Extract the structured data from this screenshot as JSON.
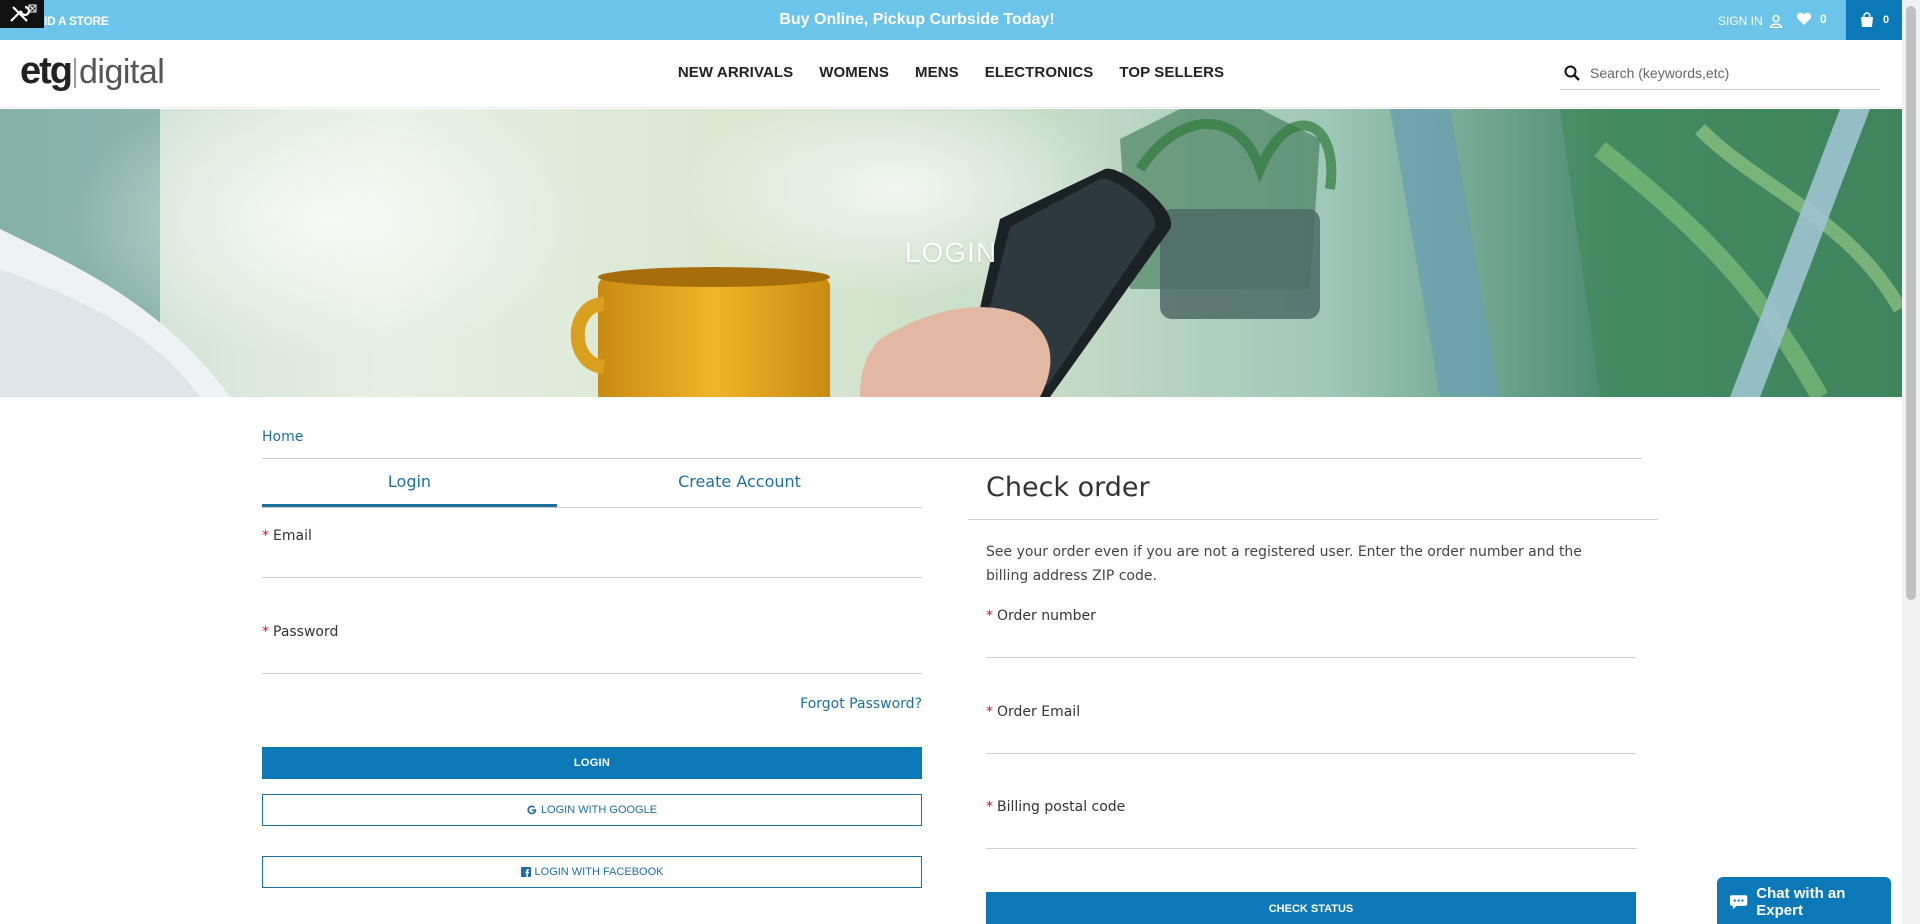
{
  "topbar": {
    "find_store": "ID A STORE",
    "promo": "Buy Online, Pickup Curbside Today!",
    "signin": "SIGN IN",
    "wishlist_count": "0",
    "cart_count": "0"
  },
  "header": {
    "logo_etg": "etg",
    "logo_digital": "digital",
    "nav": [
      "NEW ARRIVALS",
      "WOMENS",
      "MENS",
      "ELECTRONICS",
      "TOP SELLERS"
    ],
    "search_placeholder": "Search (keywords,etc)"
  },
  "hero": {
    "title": "LOGIN"
  },
  "breadcrumb": {
    "home": "Home"
  },
  "login": {
    "tabs": [
      "Login",
      "Create Account"
    ],
    "email_label": "Email",
    "password_label": "Password",
    "forgot": "Forgot Password?",
    "login_button": "LOGIN",
    "google_button": "LOGIN WITH GOOGLE",
    "facebook_button": "LOGIN WITH FACEBOOK"
  },
  "check_order": {
    "title": "Check order",
    "description": "See your order even if you are not a registered user. Enter the order number and the billing address ZIP code.",
    "order_number_label": "Order number",
    "order_email_label": "Order Email",
    "postal_label": "Billing postal code",
    "button": "CHECK STATUS"
  },
  "chat": {
    "label": "Chat with an Expert"
  },
  "colors": {
    "topbar": "#6cc4ea",
    "primary": "#0b78b7",
    "link": "#1f6f9e",
    "required": "#d0182a"
  }
}
